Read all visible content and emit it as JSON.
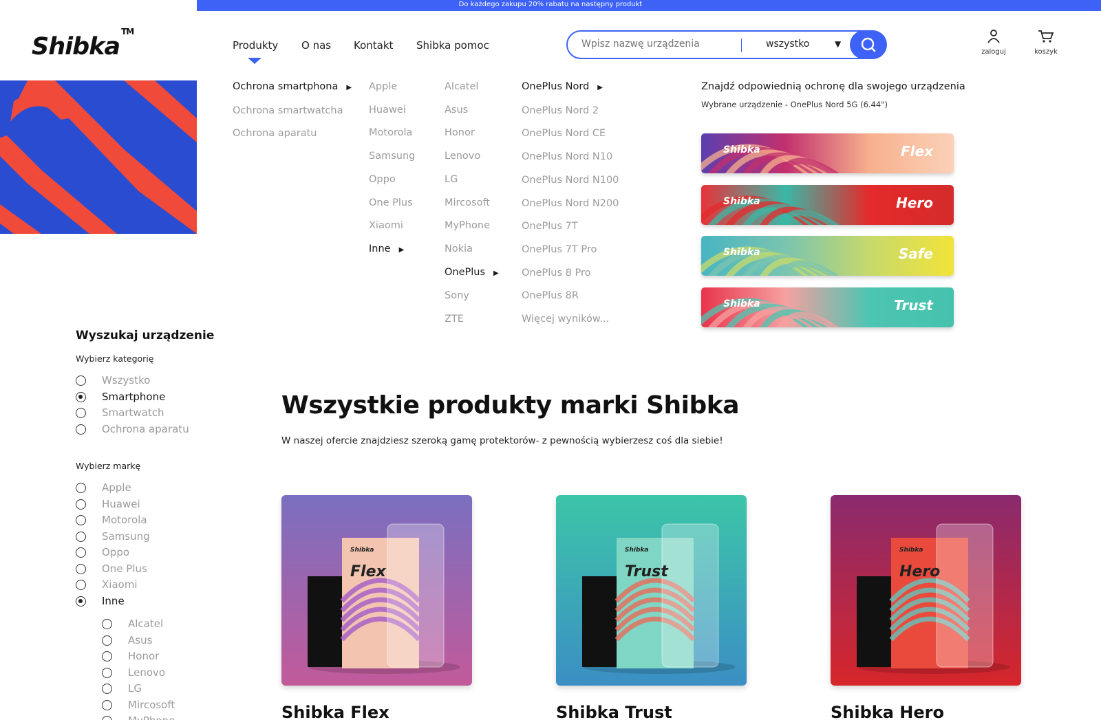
{
  "promo_bar": {
    "text": "Do każdego zakupu 20% rabatu na następny produkt"
  },
  "header": {
    "logo": "Shibka",
    "logo_tm": "TM",
    "nav": [
      "Produkty",
      "O nas",
      "Kontakt",
      "Shibka pomoc"
    ],
    "search": {
      "placeholder": "Wpisz nazwę urządzenia",
      "category": "wszystko"
    },
    "login_label": "zaloguj",
    "cart_label": "koszyk"
  },
  "mega_menu": {
    "categories": [
      {
        "label": "Ochrona smartphona",
        "active": true
      },
      {
        "label": "Ochrona smartwatcha",
        "active": false
      },
      {
        "label": "Ochrona aparatu",
        "active": false
      }
    ],
    "brands": [
      {
        "label": "Apple",
        "active": false
      },
      {
        "label": "Huawei",
        "active": false
      },
      {
        "label": "Motorola",
        "active": false
      },
      {
        "label": "Samsung",
        "active": false
      },
      {
        "label": "Oppo",
        "active": false
      },
      {
        "label": "One Plus",
        "active": false
      },
      {
        "label": "Xiaomi",
        "active": false
      },
      {
        "label": "Inne",
        "active": true
      }
    ],
    "other_brands": [
      {
        "label": "Alcatel",
        "active": false
      },
      {
        "label": "Asus",
        "active": false
      },
      {
        "label": "Honor",
        "active": false
      },
      {
        "label": "Lenovo",
        "active": false
      },
      {
        "label": "LG",
        "active": false
      },
      {
        "label": "Mircosoft",
        "active": false
      },
      {
        "label": "MyPhone",
        "active": false
      },
      {
        "label": "Nokia",
        "active": false
      },
      {
        "label": "OnePlus",
        "active": true
      },
      {
        "label": "Sony",
        "active": false
      },
      {
        "label": "ZTE",
        "active": false
      }
    ],
    "models": [
      {
        "label": "OnePlus Nord",
        "active": true
      },
      {
        "label": "OnePlus Nord 2",
        "active": false
      },
      {
        "label": "OnePlus Nord CE",
        "active": false
      },
      {
        "label": "OnePlus Nord N10",
        "active": false
      },
      {
        "label": "OnePlus Nord N100",
        "active": false
      },
      {
        "label": "OnePlus Nord N200",
        "active": false
      },
      {
        "label": "OnePlus 7T",
        "active": false
      },
      {
        "label": "OnePlus 7T Pro",
        "active": false
      },
      {
        "label": "OnePlus 8 Pro",
        "active": false
      },
      {
        "label": "OnePlus 8R",
        "active": false
      },
      {
        "label": "Więcej wyników...",
        "active": false
      }
    ],
    "promo_title": "Znajdź odpowiednią ochronę dla swojego urządzenia",
    "promo_sub": "Wybrane urządzenie - OnePlus Nord 5G (6.44\")",
    "banners": [
      {
        "logo": "Shibka",
        "name": "Flex",
        "gradient": [
          "#5b3fb0",
          "#c2306e",
          "#f7b08d",
          "#fbd1b8"
        ]
      },
      {
        "logo": "Shibka",
        "name": "Hero",
        "gradient": [
          "#e8333a",
          "#3bb7a6",
          "#e52a2a",
          "#d42b2b"
        ]
      },
      {
        "logo": "Shibka",
        "name": "Safe",
        "gradient": [
          "#48b5c2",
          "#7ac4b0",
          "#c7d96b",
          "#f2e33a"
        ]
      },
      {
        "logo": "Shibka",
        "name": "Trust",
        "gradient": [
          "#e8344c",
          "#f6a0a0",
          "#4cc5b2",
          "#45c2ad"
        ]
      }
    ]
  },
  "sidebar": {
    "title": "Wyszukaj urządzenie",
    "category_label": "Wybierz kategorię",
    "categories": [
      {
        "label": "Wszystko",
        "checked": false
      },
      {
        "label": "Smartphone",
        "checked": true
      },
      {
        "label": "Smartwatch",
        "checked": false
      },
      {
        "label": "Ochrona aparatu",
        "checked": false
      }
    ],
    "brand_label": "Wybierz markę",
    "brands": [
      {
        "label": "Apple",
        "checked": false
      },
      {
        "label": "Huawei",
        "checked": false
      },
      {
        "label": "Motorola",
        "checked": false
      },
      {
        "label": "Samsung",
        "checked": false
      },
      {
        "label": "Oppo",
        "checked": false
      },
      {
        "label": "One Plus",
        "checked": false
      },
      {
        "label": "Xiaomi",
        "checked": false
      },
      {
        "label": "Inne",
        "checked": true
      }
    ],
    "sub_brands": [
      {
        "label": "Alcatel",
        "checked": false
      },
      {
        "label": "Asus",
        "checked": false
      },
      {
        "label": "Honor",
        "checked": false
      },
      {
        "label": "Lenovo",
        "checked": false
      },
      {
        "label": "LG",
        "checked": false
      },
      {
        "label": "Mircosoft",
        "checked": false
      },
      {
        "label": "MyPhone",
        "checked": false
      }
    ]
  },
  "main": {
    "title": "Wszystkie produkty marki Shibka",
    "description": "W naszej ofercie znajdziesz szeroką gamę protektorów- z pewnością wybierzesz coś dla siebie!",
    "products": [
      {
        "name": "Shibka Flex",
        "box_label": "Flex",
        "bg": [
          "#7a6fc0",
          "#c25a9a"
        ],
        "box": [
          "#f3c4b0",
          "#a45bc8"
        ]
      },
      {
        "name": "Shibka Trust",
        "box_label": "Trust",
        "bg": [
          "#3cc5a8",
          "#3b8fc4"
        ],
        "box": [
          "#7fd6c4",
          "#e86a5a"
        ]
      },
      {
        "name": "Shibka Hero",
        "box_label": "Hero",
        "bg": [
          "#8a2a6e",
          "#d6262a"
        ],
        "box": [
          "#ea4a3c",
          "#63c3bd"
        ]
      }
    ]
  }
}
